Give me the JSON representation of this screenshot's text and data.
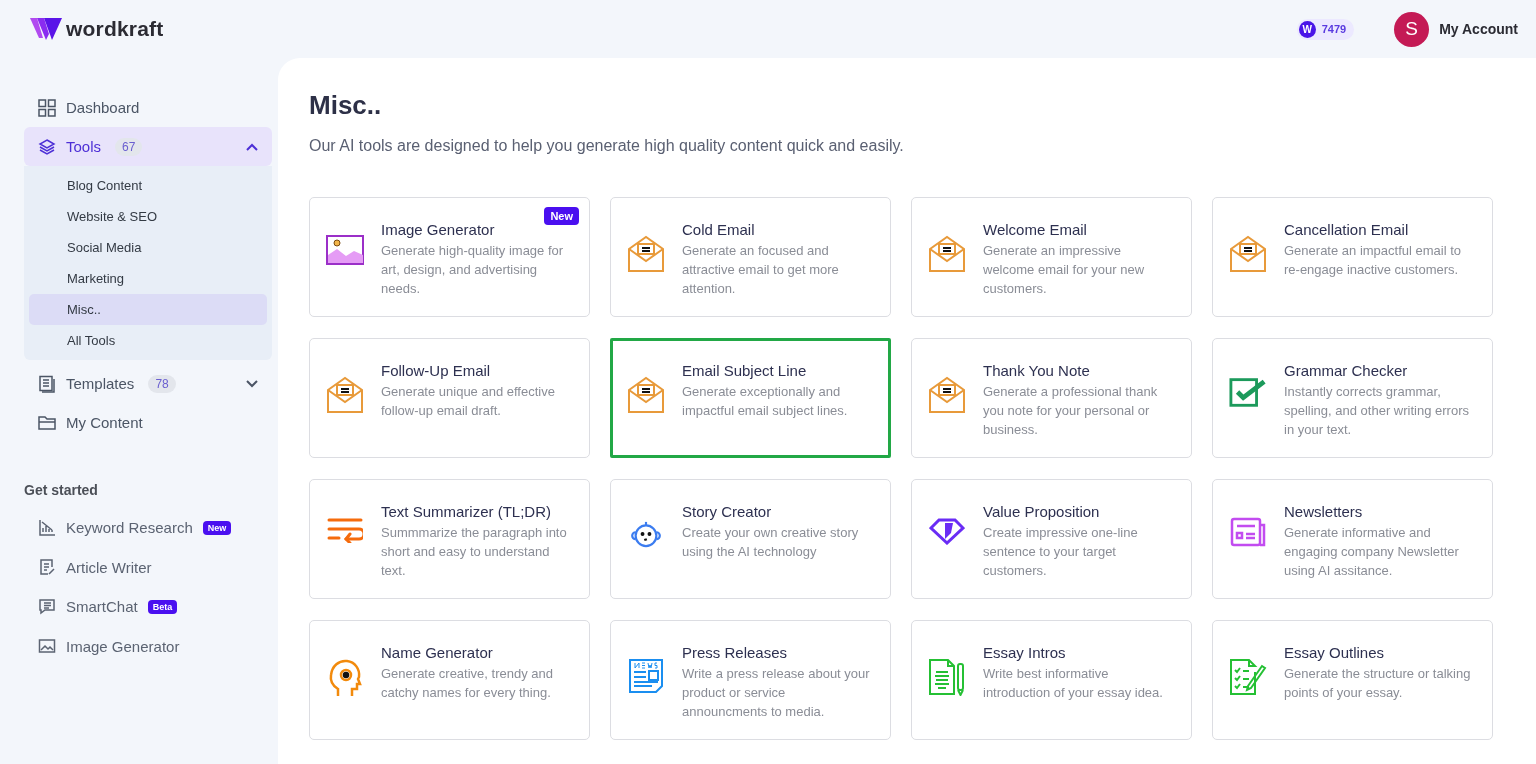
{
  "header": {
    "brand": "wordkraft",
    "credits": {
      "icon_letter": "W",
      "count": "7479"
    },
    "account": {
      "initial": "S",
      "label": "My Account"
    }
  },
  "sidebar": {
    "nav": [
      {
        "label": "Dashboard",
        "kind": "dashboard",
        "selected": false
      },
      {
        "label": "Tools",
        "kind": "tools",
        "count": "67",
        "expanded": true,
        "selected": true,
        "children": [
          {
            "label": "Blog Content",
            "selected": false
          },
          {
            "label": "Website & SEO",
            "selected": false
          },
          {
            "label": "Social Media",
            "selected": false
          },
          {
            "label": "Marketing",
            "selected": false
          },
          {
            "label": "Misc..",
            "selected": true
          },
          {
            "label": "All Tools",
            "selected": false
          }
        ]
      },
      {
        "label": "Templates",
        "kind": "templates",
        "count": "78",
        "expanded": false,
        "selected": false
      },
      {
        "label": "My Content",
        "kind": "folder",
        "selected": false
      }
    ],
    "section_title": "Get started",
    "quick_links": [
      {
        "label": "Keyword Research",
        "kind": "chart",
        "badge": "New"
      },
      {
        "label": "Article Writer",
        "kind": "article"
      },
      {
        "label": "SmartChat",
        "kind": "chat",
        "badge": "Beta"
      },
      {
        "label": "Image Generator",
        "kind": "image"
      }
    ]
  },
  "page": {
    "title": "Misc..",
    "subtitle": "Our AI tools are designed to help you generate high quality content quick and easily."
  },
  "cards": [
    {
      "title": "Image Generator",
      "description": "Generate high-quality image for art, design, and advertising needs.",
      "kind": "image",
      "badge": "New",
      "selected": false
    },
    {
      "title": "Cold Email",
      "description": "Generate an focused and attractive email to get more attention.",
      "kind": "envelope",
      "selected": false
    },
    {
      "title": "Welcome Email",
      "description": "Generate an impressive welcome email for your new customers.",
      "kind": "envelope",
      "selected": false
    },
    {
      "title": "Cancellation Email",
      "description": "Generate an impactful email to re-engage inactive customers.",
      "kind": "envelope",
      "selected": false
    },
    {
      "title": "Follow-Up Email",
      "description": "Generate unique and effective follow-up email draft.",
      "kind": "envelope",
      "selected": false
    },
    {
      "title": "Email Subject Line",
      "description": "Generate exceptionally and impactful email subject lines.",
      "kind": "envelope",
      "selected": true
    },
    {
      "title": "Thank You Note",
      "description": "Generate a professional thank you note for your personal or business.",
      "kind": "envelope",
      "selected": false
    },
    {
      "title": "Grammar Checker",
      "description": "Instantly corrects grammar, spelling, and other writing errors in your text.",
      "kind": "check",
      "selected": false
    },
    {
      "title": "Text Summarizer (TL;DR)",
      "description": "Summmarize the paragraph into short and easy to understand text.",
      "kind": "wrap",
      "selected": false
    },
    {
      "title": "Story Creator",
      "description": "Create your own creative story using the AI technology",
      "kind": "robot",
      "selected": false
    },
    {
      "title": "Value Proposition",
      "description": "Create impressive one-line sentence to your target customers.",
      "kind": "diamond",
      "selected": false
    },
    {
      "title": "Newsletters",
      "description": "Generate informative and engaging company Newsletter using AI assitance.",
      "kind": "newsletter",
      "selected": false
    },
    {
      "title": "Name Generator",
      "description": "Generate creative, trendy and catchy names for every thing.",
      "kind": "head",
      "selected": false
    },
    {
      "title": "Press Releases",
      "description": "Write a press release about your product or service announcments to media.",
      "kind": "news",
      "selected": false
    },
    {
      "title": "Essay Intros",
      "description": "Write best informative introduction of your essay idea.",
      "kind": "essay",
      "selected": false
    },
    {
      "title": "Essay Outlines",
      "description": "Generate the structure or talking points of your essay.",
      "kind": "outline",
      "selected": false
    }
  ]
}
